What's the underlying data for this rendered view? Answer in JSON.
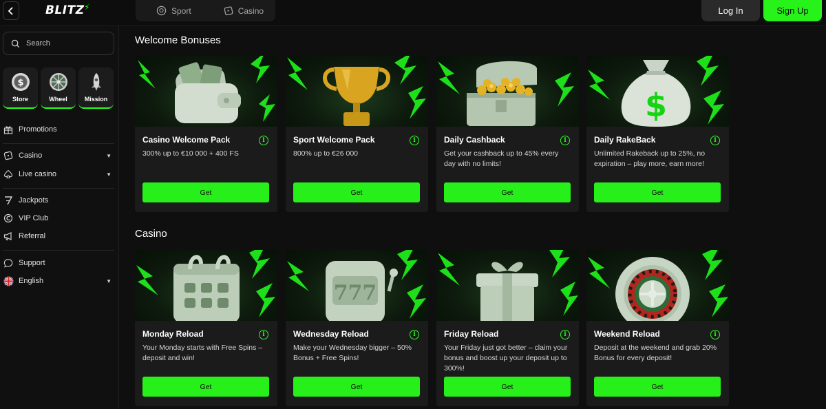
{
  "header": {
    "logo": "BLITZ",
    "switch": [
      {
        "label": "Sport",
        "icon": "ball-icon"
      },
      {
        "label": "Casino",
        "icon": "dice-icon"
      }
    ],
    "login_label": "Log In",
    "signup_label": "Sign Up"
  },
  "sidebar": {
    "search_placeholder": "Search",
    "quick": [
      {
        "label": "Store",
        "icon": "coin-icon"
      },
      {
        "label": "Wheel",
        "icon": "wheel-icon"
      },
      {
        "label": "Mission",
        "icon": "rocket-icon"
      }
    ],
    "items": [
      {
        "label": "Promotions",
        "icon": "gift-icon"
      },
      {
        "label": "Casino",
        "icon": "dice-icon"
      },
      {
        "label": "Live casino",
        "icon": "spade-icon"
      },
      {
        "label": "Jackpots",
        "icon": "seven-icon"
      },
      {
        "label": "VIP Club",
        "icon": "vip-icon"
      },
      {
        "label": "Referral",
        "icon": "megaphone-icon"
      },
      {
        "label": "Support",
        "icon": "chat-icon"
      },
      {
        "label": "English",
        "icon": "uk-flag-icon"
      }
    ]
  },
  "sections": [
    {
      "title": "Welcome Bonuses",
      "cards": [
        {
          "title": "Casino Welcome Pack",
          "desc": "300% up to €10 000 + 400 FS",
          "button": "Get",
          "image": "wallet"
        },
        {
          "title": "Sport Welcome Pack",
          "desc": "800% up to €26 000",
          "button": "Get",
          "image": "trophy"
        },
        {
          "title": "Daily Cashback",
          "desc": "Get your cashback up to 45% every day with no limits!",
          "button": "Get",
          "image": "chest"
        },
        {
          "title": "Daily RakeBack",
          "desc": "Unlimited Rakeback up to 25%, no expiration – play more, earn more!",
          "button": "Get",
          "image": "moneybag"
        }
      ]
    },
    {
      "title": "Casino",
      "cards": [
        {
          "title": "Monday Reload",
          "desc": "Your Monday starts with Free Spins – deposit and win!",
          "button": "Get",
          "image": "calendar"
        },
        {
          "title": "Wednesday Reload",
          "desc": "Make your Wednesday bigger – 50% Bonus + Free Spins!",
          "button": "Get",
          "image": "slot"
        },
        {
          "title": "Friday Reload",
          "desc": "Your Friday just got better – claim your bonus and boost up your deposit up to 300%!",
          "button": "Get",
          "image": "gift"
        },
        {
          "title": "Weekend Reload",
          "desc": "Deposit at the weekend and grab 20% Bonus for every deposit!",
          "button": "Get",
          "image": "roulette"
        }
      ]
    }
  ],
  "colors": {
    "accent": "#27ff1b",
    "background": "#0f0f0f",
    "card": "#1b1b1b"
  }
}
